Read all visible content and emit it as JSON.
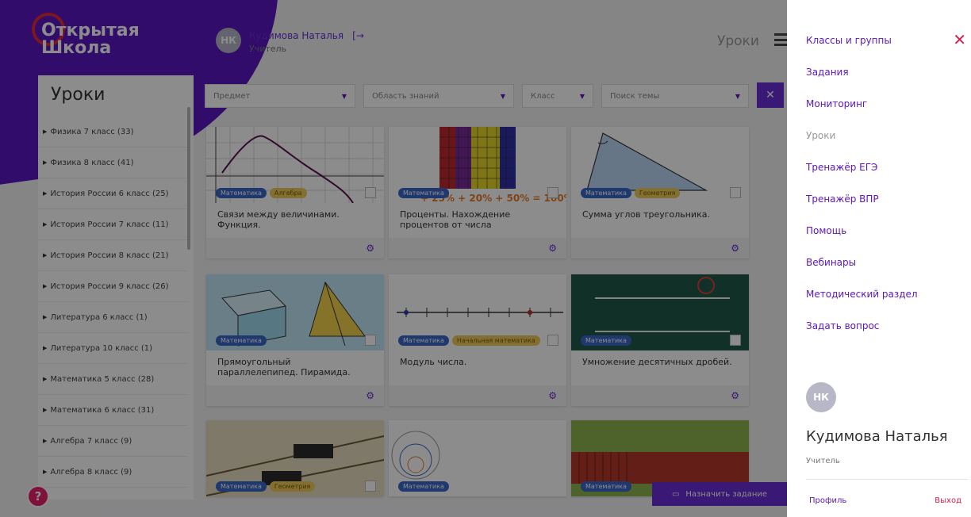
{
  "brand": {
    "line1": "Открытая",
    "line2": "Школа"
  },
  "header": {
    "user_initials": "НК",
    "user_name": "Кудимова Наталья",
    "user_role": "Учитель",
    "section": "Уроки"
  },
  "sidebar": {
    "title": "Уроки",
    "items": [
      "Физика 7 класс (33)",
      "Физика 8 класс (41)",
      "История России 6 класс (25)",
      "История России 7 класс (11)",
      "История России 8 класс (21)",
      "История России 9 класс (26)",
      "Литература 6 класс (1)",
      "Литература 10 класс (1)",
      "Математика 5 класс (28)",
      "Математика 6 класс (31)",
      "Алгебра 7 класс (9)",
      "Алгебра 8 класс (9)"
    ]
  },
  "filters": {
    "subject": "Предмет",
    "area": "Область знаний",
    "grade": "Класс",
    "topic": "Поиск темы"
  },
  "cards": [
    {
      "title": "Связи между величинами. Функция.",
      "tags": [
        "Математика",
        "Алгебра"
      ]
    },
    {
      "title": "Проценты. Нахождение процентов от числа",
      "tags": [
        "Математика"
      ]
    },
    {
      "title": "Сумма углов треугольника.",
      "tags": [
        "Математика",
        "Геометрия"
      ]
    },
    {
      "title": "Прямоугольный параллелепипед. Пирамида.",
      "tags": [
        "Математика"
      ]
    },
    {
      "title": "Модуль числа.",
      "tags": [
        "Математика",
        "Начальная математика"
      ]
    },
    {
      "title": "Умножение десятичных дробей.",
      "tags": [
        "Математика"
      ]
    },
    {
      "title": "",
      "tags": [
        "Математика",
        "Геометрия"
      ]
    },
    {
      "title": "",
      "tags": [
        "Математика"
      ]
    },
    {
      "title": "",
      "tags": [
        "Математика"
      ]
    }
  ],
  "assign_button": "Назначить задание",
  "help_button": "?",
  "drawer": {
    "menu": [
      "Классы и группы",
      "Задания",
      "Мониторинг",
      "Уроки",
      "Тренажёр ЕГЭ",
      "Тренажёр ВПР",
      "Помощь",
      "Вебинары",
      "Методический раздел",
      "Задать вопрос"
    ],
    "active_item": "Уроки",
    "avatar_initials": "НК",
    "name": "Кудимова Наталья",
    "role": "Учитель",
    "profile": "Профиль",
    "logout": "Выход"
  },
  "colors": {
    "accent": "#5a16c2",
    "danger": "#d6234e",
    "help": "#e8206b"
  }
}
